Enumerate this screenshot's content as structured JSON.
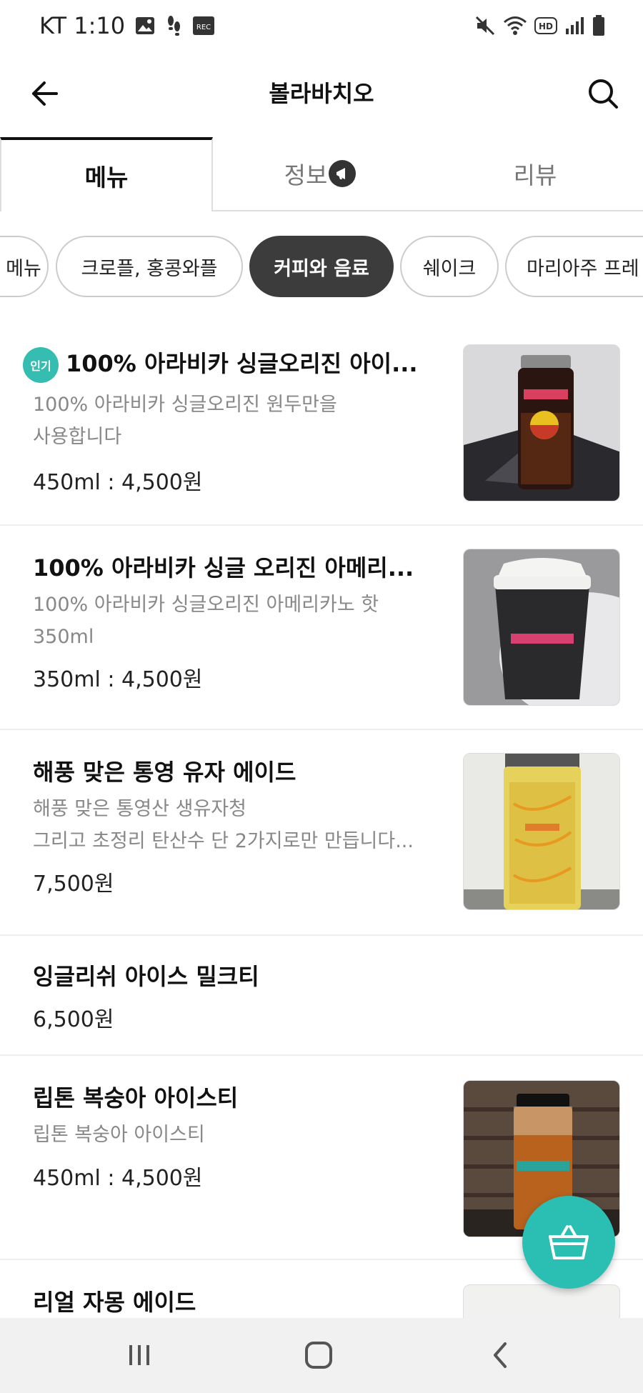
{
  "status_bar": {
    "carrier_time": "KT 1:10",
    "icons": [
      "gallery-icon",
      "footsteps-icon",
      "rec-icon",
      "mute-icon",
      "wifi-icon",
      "hd-icon",
      "signal-icon",
      "battery-icon"
    ],
    "hd_label": "HD",
    "rec_label": "REC"
  },
  "header": {
    "title": "볼라바치오",
    "back_icon": "arrow-left-icon",
    "search_icon": "search-icon"
  },
  "tabs": [
    {
      "label": "메뉴",
      "active": true
    },
    {
      "label": "정보",
      "active": false
    },
    {
      "label": "리뷰",
      "active": false
    }
  ],
  "chips": [
    {
      "label": "메뉴",
      "active": false
    },
    {
      "label": "크로플, 홍콩와플",
      "active": false
    },
    {
      "label": "커피와 음료",
      "active": true
    },
    {
      "label": "쉐이크",
      "active": false
    },
    {
      "label": "마리아주 프레",
      "active": false
    }
  ],
  "menu_items": [
    {
      "name": "100% 아라비카 싱글오리진 아이...",
      "popular_badge": "인기",
      "desc_lines": [
        "100% 아라비카 싱글오리진 원두만을",
        "사용합니다"
      ],
      "price": "450ml : 4,500원",
      "has_image": true
    },
    {
      "name": "100% 아라비카 싱글 오리진 아메리...",
      "desc_lines": [
        "100% 아라비카 싱글오리진 아메리카노 핫",
        "350ml"
      ],
      "price": "350ml : 4,500원",
      "has_image": true
    },
    {
      "name": "해풍 맞은 통영 유자 에이드",
      "desc_lines": [
        "해풍 맞은 통영산 생유자청",
        "그리고 초정리 탄산수 단 2가지로만 만듭니다..."
      ],
      "price": "7,500원",
      "has_image": true
    },
    {
      "name": "잉글리쉬 아이스 밀크티",
      "desc_lines": [],
      "price": "6,500원",
      "has_image": false
    },
    {
      "name": "립톤 복숭아 아이스티",
      "desc_lines": [
        "립톤 복숭아 아이스티"
      ],
      "price": "450ml : 4,500원",
      "has_image": true
    },
    {
      "name": "리얼 자몽 에이드",
      "desc_lines": [],
      "price": "",
      "has_image": true
    }
  ],
  "cart_fab": {
    "icon": "cart-basket-icon"
  },
  "nav_bar": {
    "icons": [
      "recent-apps-icon",
      "home-icon",
      "back-icon"
    ]
  },
  "colors": {
    "accent": "#2bbfb3",
    "active_chip": "#3c3c3c",
    "text_muted": "#888888"
  }
}
